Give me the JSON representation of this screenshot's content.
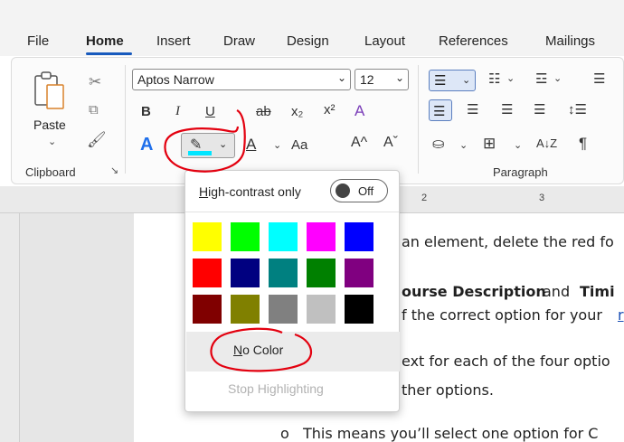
{
  "tabs": [
    "File",
    "Home",
    "Insert",
    "Draw",
    "Design",
    "Layout",
    "References",
    "Mailings"
  ],
  "clipboard": {
    "paste_label": "Paste",
    "group_label": "Clipboard"
  },
  "font": {
    "name": "Aptos Narrow",
    "size": "12"
  },
  "buttons": {
    "bold": "B",
    "italic": "I",
    "underline": "U",
    "strike": "ab",
    "subscript": "x₂",
    "superscript": "x²",
    "font_color_letter": "A",
    "change_case": "Aa",
    "grow": "A^",
    "shrink": "Aˇ",
    "pilcrow": "¶",
    "sort": "A↓Z"
  },
  "paragraph": {
    "group_label": "Paragraph"
  },
  "highlight_menu": {
    "high_contrast_label": "High-contrast only",
    "toggle_state": "Off",
    "colors": [
      "#ffff00",
      "#00ff00",
      "#00ffff",
      "#ff00ff",
      "#0000ff",
      "#ff0000",
      "#000080",
      "#008080",
      "#008000",
      "#800080",
      "#800000",
      "#808000",
      "#808080",
      "#c0c0c0",
      "#000000"
    ],
    "no_color": "No Color",
    "stop_highlighting": "Stop Highlighting"
  },
  "ruler": {
    "mark2": "2",
    "mark3": "3"
  },
  "document": {
    "line1": "an element, delete the red fo",
    "line2a": "ourse Description",
    "line2b": " and ",
    "line2c": "Timi",
    "line3": "f the correct option for your ",
    "line3b": "r",
    "line4": "ext for each of the four optio",
    "line5": "ther options.",
    "bullet": "o",
    "line6": "This means you’ll select one option for C"
  },
  "colors": {
    "accent": "#185abd",
    "annotation": "#e3000f",
    "highlight_underline": "#00e5ff"
  }
}
